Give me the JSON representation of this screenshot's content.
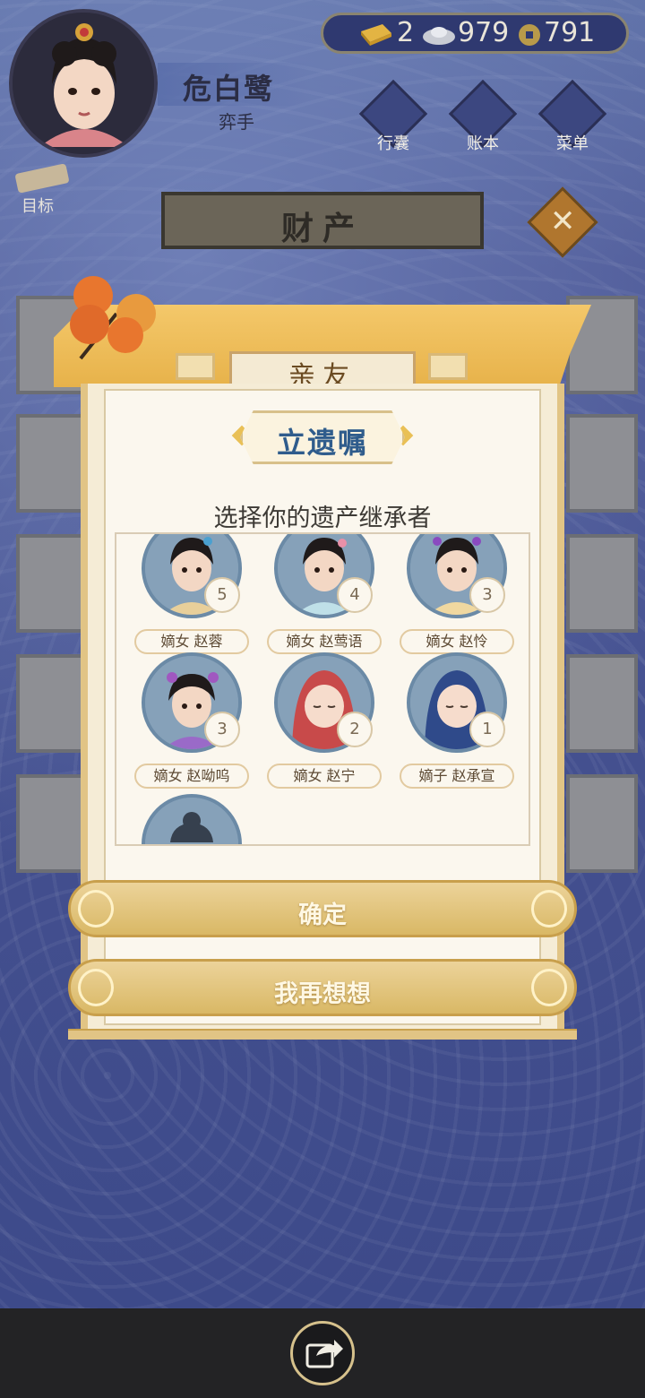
{
  "player": {
    "name": "危白鹭",
    "title": "弈手"
  },
  "currency": {
    "gold": "2",
    "silver": "979",
    "coin": "791"
  },
  "top_menu": [
    {
      "label": "行囊",
      "icon": "bag-icon"
    },
    {
      "label": "账本",
      "icon": "ledger-icon"
    },
    {
      "label": "菜单",
      "icon": "more-icon"
    }
  ],
  "goal_label": "目标",
  "page_title": "财产",
  "close_label": "✕",
  "dialog": {
    "tab": "亲友",
    "heading": "立遗嘱",
    "prompt": "选择你的遗产继承者",
    "heirs": [
      {
        "label": "嫡女 赵蓉",
        "rank": "5"
      },
      {
        "label": "嫡女 赵莺语",
        "rank": "4"
      },
      {
        "label": "嫡女 赵怜",
        "rank": "3"
      },
      {
        "label": "嫡女 赵呦呜",
        "rank": "3"
      },
      {
        "label": "嫡女 赵宁",
        "rank": "2"
      },
      {
        "label": "嫡子 赵承宣",
        "rank": "1"
      }
    ],
    "confirm_label": "确定",
    "cancel_label": "我再想想"
  },
  "colors": {
    "background": "#46528f",
    "panel": "#f5ecd6",
    "gold_button": "#d9b865",
    "heading_text": "#2f5c8c"
  }
}
